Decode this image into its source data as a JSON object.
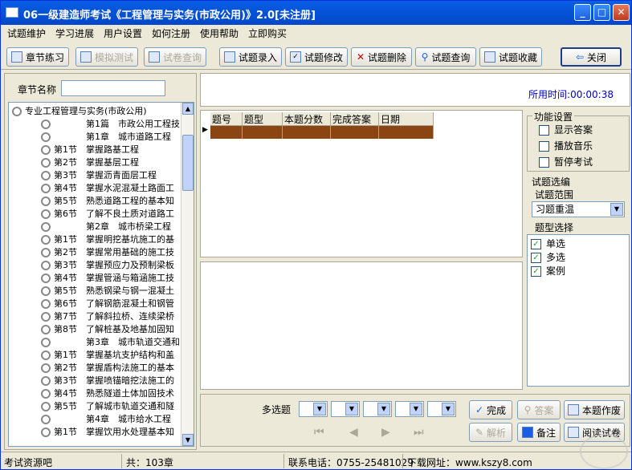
{
  "window": {
    "title": "06一级建造师考试《工程管理与实务(市政公用)》2.0[未注册]",
    "min": "_",
    "max": "□",
    "close": "✕"
  },
  "menu": [
    "试题维护",
    "学习进展",
    "用户设置",
    "如何注册",
    "使用帮助",
    "立即购买"
  ],
  "toolbar": {
    "chapter_practice": "章节练习",
    "mock_test": "模拟测试",
    "paper_query": "试卷查询",
    "entry": "试题录入",
    "modify": "试题修改",
    "delete": "试题删除",
    "query": "试题查询",
    "favorite": "试题收藏",
    "close": "关闭"
  },
  "left": {
    "chapter_name_label": "章节名称",
    "search_value": "",
    "tree": [
      {
        "text": "专业工程管理与实务(市政公用)",
        "level": 0
      },
      {
        "text": "第1篇　市政公用工程技",
        "level": 2
      },
      {
        "text": "第1章　城市道路工程",
        "level": 2
      },
      {
        "text": "第1节　掌握路基工程",
        "level": 1
      },
      {
        "text": "第2节　掌握基层工程",
        "level": 1
      },
      {
        "text": "第3节　掌握沥青面层工程",
        "level": 1
      },
      {
        "text": "第4节　掌握水泥混凝土路面工",
        "level": 1
      },
      {
        "text": "第5节　熟悉道路工程的基本知",
        "level": 1
      },
      {
        "text": "第6节　了解不良土质对道路工",
        "level": 1
      },
      {
        "text": "第2章　城市桥梁工程",
        "level": 2
      },
      {
        "text": "第1节　掌握明挖基坑施工的基",
        "level": 1
      },
      {
        "text": "第2节　掌握常用基础的施工技",
        "level": 1
      },
      {
        "text": "第3节　掌握预应力及预制梁板",
        "level": 1
      },
      {
        "text": "第4节　掌握管涵与箱涵施工技",
        "level": 1
      },
      {
        "text": "第5节　熟悉钢梁与钢一混凝土",
        "level": 1
      },
      {
        "text": "第6节　了解钢筋混凝土和钢管",
        "level": 1
      },
      {
        "text": "第7节　了解斜拉桥、连续梁桥",
        "level": 1
      },
      {
        "text": "第8节　了解桩基及地基加固知",
        "level": 1
      },
      {
        "text": "第3章　城市轨道交通和",
        "level": 2
      },
      {
        "text": "第1节　掌握基坑支护结构和盖",
        "level": 1
      },
      {
        "text": "第2节　掌握盾构法施工的基本",
        "level": 1
      },
      {
        "text": "第3节　掌握喷锚暗挖法施工的",
        "level": 1
      },
      {
        "text": "第4节　熟悉隧道土体加固技术",
        "level": 1
      },
      {
        "text": "第5节　了解城市轨道交通和隧",
        "level": 1
      },
      {
        "text": "第4章　城市给水工程",
        "level": 2
      },
      {
        "text": "第1节　掌握饮用水处理基本知",
        "level": 1
      }
    ]
  },
  "timer": {
    "label": "所用时间:00:00:38"
  },
  "grid": {
    "headers": [
      "题号",
      "题型",
      "本题分数",
      "完成答案",
      "日期"
    ]
  },
  "functions": {
    "title": "功能设置",
    "items": [
      {
        "label": "显示答案",
        "checked": false
      },
      {
        "label": "播放音乐",
        "checked": false
      },
      {
        "label": "暂停考试",
        "checked": false
      }
    ]
  },
  "selection": {
    "title": "试题选编",
    "range_label": "试题范围",
    "range_value": "习题重温",
    "type_label": "题型选择",
    "types": [
      {
        "label": "单选",
        "checked": true
      },
      {
        "label": "多选",
        "checked": true
      },
      {
        "label": "案例",
        "checked": true
      }
    ]
  },
  "bottom": {
    "multi_label": "多选题",
    "done": "完成",
    "answer": "答案",
    "draft": "本题作废",
    "analysis": "解析",
    "note": "备注",
    "read": "阅读试卷"
  },
  "status": {
    "resource": "考试资源吧",
    "total": "共：103章",
    "phone": "联系电话：0755-25481029",
    "site": "下载网址：www.kszy8.com"
  }
}
